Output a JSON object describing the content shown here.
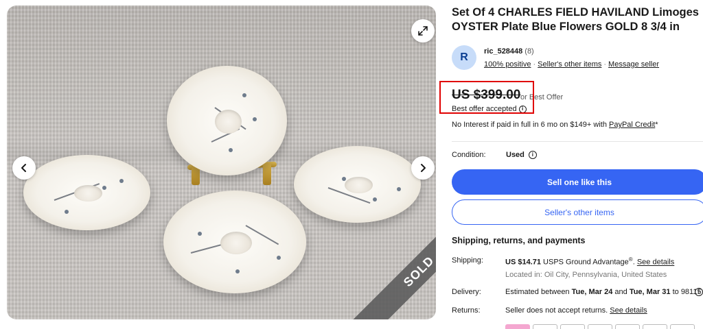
{
  "gallery": {
    "sold_label": "SOLD",
    "expand_icon": "expand-icon",
    "prev_icon": "chevron-left-icon",
    "next_icon": "chevron-right-icon"
  },
  "listing": {
    "title": "Set Of 4 CHARLES FIELD HAVILAND Limoges OYSTER Plate Blue Flowers GOLD 8 3/4 in"
  },
  "seller": {
    "avatar_letter": "R",
    "name": "ric_528448",
    "feedback_count": "(8)",
    "positive": "100% positive",
    "other_items_link": "Seller's other items",
    "message_link": "Message seller"
  },
  "price": {
    "value": "US $399.00",
    "or_best_offer": "or Best Offer",
    "offer_status": "Best offer accepted",
    "highlight_color": "#e00000"
  },
  "financing": {
    "text": "No Interest if paid in full in 6 mo on $149+ with ",
    "link": "PayPal Credit",
    "suffix": "*"
  },
  "condition": {
    "label": "Condition:",
    "value": "Used"
  },
  "buttons": {
    "primary": "Sell one like this",
    "secondary": "Seller's other items",
    "primary_color": "#3665f3"
  },
  "shipping": {
    "heading": "Shipping, returns, and payments",
    "shipping_label": "Shipping:",
    "shipping_cost": "US $14.71",
    "shipping_service": " USPS Ground Advantage",
    "shipping_reg": "®",
    "shipping_period": ". ",
    "shipping_link": "See details",
    "location": "Located in: Oil City, Pennsylvania, United States",
    "delivery_label": "Delivery:",
    "delivery_prefix": "Estimated between ",
    "delivery_start": "Tue, Mar 24",
    "delivery_and": " and ",
    "delivery_end": "Tue, Mar 31",
    "delivery_to": " to 98115",
    "returns_label": "Returns:",
    "returns_text": "Seller does not accept returns. ",
    "returns_link": "See details"
  }
}
